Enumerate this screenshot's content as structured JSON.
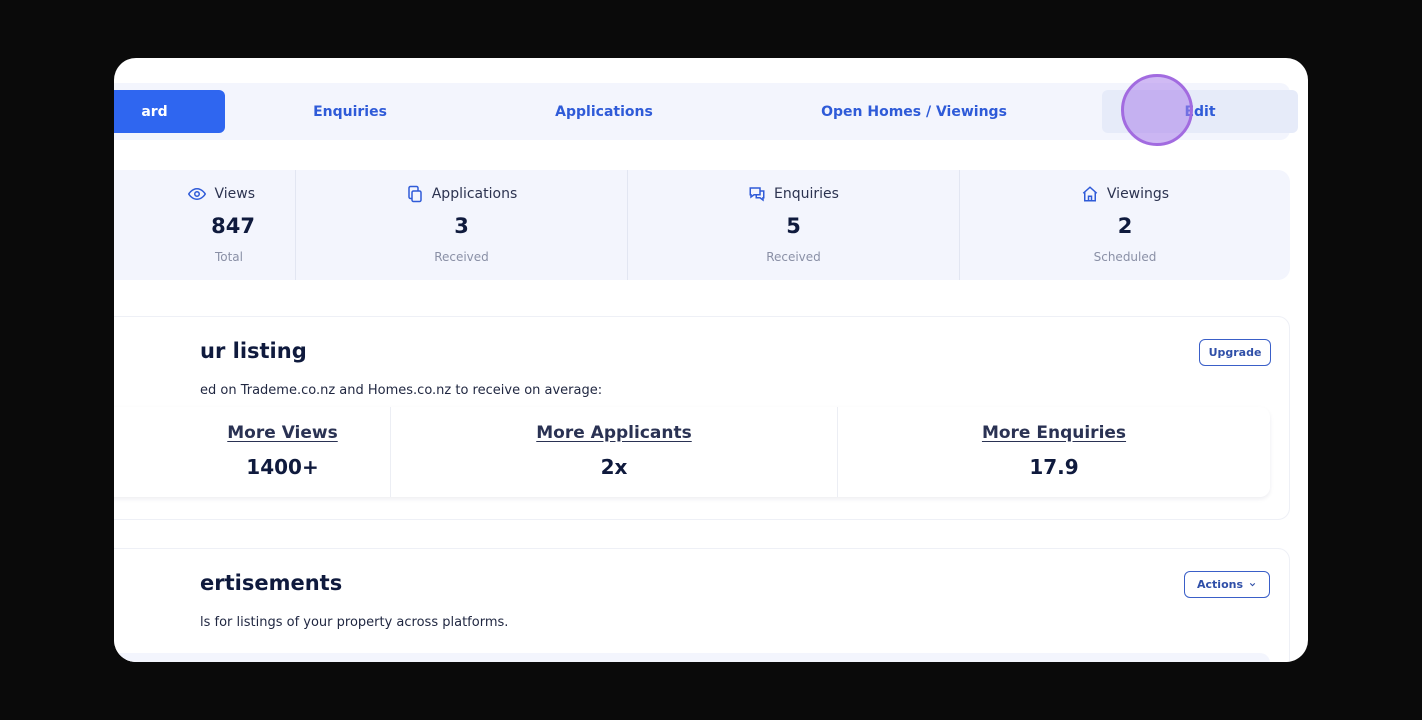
{
  "tabs": [
    {
      "label": "ard"
    },
    {
      "label": "Enquiries"
    },
    {
      "label": "Applications"
    },
    {
      "label": "Open Homes / Viewings"
    },
    {
      "label": "Edit"
    }
  ],
  "stats": [
    {
      "title": "Views",
      "value": "847",
      "sub": "Total",
      "icon": "eye-icon"
    },
    {
      "title": "Applications",
      "value": "3",
      "sub": "Received",
      "icon": "copy-icon"
    },
    {
      "title": "Enquiries",
      "value": "5",
      "sub": "Received",
      "icon": "chat-icon"
    },
    {
      "title": "Viewings",
      "value": "2",
      "sub": "Scheduled",
      "icon": "home-icon"
    }
  ],
  "listing": {
    "title": "ur listing",
    "description": "ed on Trademe.co.nz and Homes.co.nz to receive on average:",
    "upgrade_label": "Upgrade",
    "metrics": [
      {
        "label": "More Views",
        "value": "1400+"
      },
      {
        "label": "More Applicants",
        "value": "2x"
      },
      {
        "label": "More Enquiries",
        "value": "17.9"
      }
    ]
  },
  "ads": {
    "title": "ertisements",
    "description": "ls for listings of your property across platforms.",
    "actions_label": "Actions"
  },
  "colors": {
    "accent": "#2f66f0",
    "text_dark": "#0f1a3d",
    "panel_bg": "#f3f5fd"
  }
}
